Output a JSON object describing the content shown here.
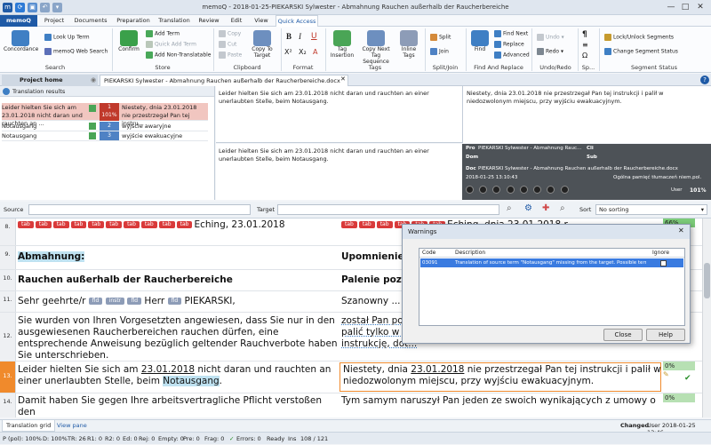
{
  "window": {
    "title": "memoQ - 2018-01-25-PIEKARSKI Sylwester - Abmahnung Rauchen außerhalb der Raucherbereiche",
    "minimize": "—",
    "maximize": "□",
    "close": "✕"
  },
  "ribbon_tabs": [
    "memoQ",
    "Project",
    "Documents",
    "Preparation",
    "Translation",
    "Review",
    "Edit",
    "View",
    "Quick Access"
  ],
  "ribbon": {
    "search": {
      "label": "Search",
      "concordance": "Concordance",
      "look_up_term": "Look Up Term",
      "web_search": "memoQ Web Search"
    },
    "store": {
      "label": "Store",
      "confirm": "Confirm",
      "add_term": "Add Term",
      "quick_add_term": "Quick Add Term",
      "add_non_translatable": "Add Non-Translatable"
    },
    "clipboard": {
      "label": "Clipboard",
      "copy": "Copy",
      "cut": "Cut",
      "paste": "Paste",
      "copy_to_target": "Copy To Target"
    },
    "format": {
      "label": "Format",
      "bold": "B",
      "italic": "I",
      "underline": "U",
      "sup": "X²",
      "sub": "X₂",
      "clear": "A"
    },
    "tags": {
      "label": "Tags",
      "tag_insertion": "Tag Insertion",
      "copy_next": "Copy Next Tag Sequence",
      "inline_tags": "Inline Tags"
    },
    "split_join": {
      "label": "Split/Join",
      "split": "Split",
      "join": "Join"
    },
    "find_replace": {
      "label": "Find And Replace",
      "find": "Find",
      "find_next": "Find Next",
      "replace": "Replace",
      "advanced": "Advanced"
    },
    "undo_redo": {
      "label": "Undo/Redo",
      "undo": "Undo",
      "redo": "Redo"
    },
    "sp": {
      "label": "Sp..."
    },
    "segment_status": {
      "label": "Segment Status",
      "lock": "Lock/Unlock Segments",
      "change_status": "Change Segment Status"
    }
  },
  "doc_tabs": {
    "home": "Project home",
    "doc": "PIEKARSKI Sylwester - Abmahnung Rauchen außerhalb der Raucherbereiche.docx"
  },
  "translation_results": {
    "title": "Translation results",
    "rows": [
      {
        "source": "Leider hielten Sie sich am 23.01.2018 nicht daran und rauchten an ...",
        "index": "1",
        "match": "101%",
        "target": "Niestety, dnia 23.01.2018 nie przestrzegał Pan tej instru..."
      },
      {
        "source": "Notausgang",
        "index": "2",
        "match": "",
        "target": "wyjście awaryjne"
      },
      {
        "source": "Notausgang",
        "index": "3",
        "match": "",
        "target": "wyjście ewakuacyjne"
      }
    ]
  },
  "compare": {
    "source_top": "Leider hielten Sie sich am 23.01.2018 nicht daran und rauchten an einer unerlaubten Stelle, beim Notausgang.",
    "source_bottom": "Leider hielten Sie sich am 23.01.2018 nicht daran und rauchten an einer unerlaubten Stelle, beim Notausgang.",
    "target_top": "Niestety, dnia 23.01.2018 nie przestrzegał Pan tej instrukcji i palił w niedozwolonym miejscu, przy wyjściu ewakuacyjnym."
  },
  "meta": {
    "pro_label": "Pro",
    "pro_value": "PIEKARSKI Sylwester - Abmahnung Rauc...",
    "cli_label": "Cli",
    "dom_label": "Dom",
    "sub_label": "Sub",
    "doc_label": "Doc",
    "doc_value": "PIEKARSKI Sylwester - Abmahnung Rauchen außerhalb der Raucherbereiche.docx",
    "date": "2018-01-25 13:10:43",
    "tm": "Ogólna pamięć tłumaczeń niem.pol.",
    "user": "User",
    "percent": "101%"
  },
  "filter": {
    "source_label": "Source",
    "target_label": "Target",
    "sort_label": "Sort",
    "sort_value": "No sorting"
  },
  "tags": {
    "tab": "tab",
    "fld": "fld",
    "instr": "instr"
  },
  "segments": [
    {
      "num": "8.",
      "source": "Eching, 23.01.2018",
      "target": "Eching, dnia 23.01.2018 r.",
      "match": "66%"
    },
    {
      "num": "9.",
      "source": "Abmahnung:",
      "target": "Upomnienie:",
      "match": ""
    },
    {
      "num": "10.",
      "source": "Rauchen außerhalb der Raucherbereiche",
      "target": "Palenie poza ...",
      "match": ""
    },
    {
      "num": "11.",
      "source_a": "Sehr geehrte/r",
      "source_b": "Herr",
      "source_c": "PIEKARSKI,",
      "target": "Szanowny ...",
      "match": ""
    },
    {
      "num": "12.",
      "source": "Sie wurden von Ihren Vorgesetzten angewiesen, dass Sie nur in den ausgewiesenen Raucherbereichen rauchen dürfen, eine entsprechende Anweisung bezüglich geltender Rauchverbote haben Sie unterschrieben.",
      "target_l1": "został Pan poi...",
      "target_l2": "palić tylko w ...",
      "target_l3": "instrukcję, dot...",
      "match": ""
    },
    {
      "num": "13.",
      "source_pre": "Leider hielten Sie sich am ",
      "source_date": "23.01.2018",
      "source_mid": " nicht daran und rauchten an einer unerlaubten Stelle, beim ",
      "source_term": "Notausgang",
      "source_post": ".",
      "target_pre": "Niestety, dnia ",
      "target_date": "23.01.2018",
      "target_rest": " nie przestrzegał Pan tej instrukcji i palił w niedozwolonym miejscu, przy wyjściu ewakuacyjnym.",
      "match": "0%"
    },
    {
      "num": "14.",
      "source": "Damit haben Sie gegen Ihre arbeitsvertragliche Pflicht verstoßen den",
      "target": "Tym samym naruszył Pan jeden ze swoich wynikających z umowy o",
      "match": "0%"
    }
  ],
  "row_status": {
    "changed": "Changed",
    "user_date": "User 2018-01-25 13:46"
  },
  "warnings": {
    "title": "Warnings",
    "col_code": "Code",
    "col_desc": "Description",
    "col_ignore": "Ignore",
    "row_code": "03091",
    "row_desc": "Translation of source term \"Notausgang\" missing from the target. Possible terms: ...",
    "close": "Close",
    "help": "Help"
  },
  "bottom_tabs": {
    "grid": "Translation grid",
    "view": "View pane"
  },
  "status": {
    "p": "P (pol): 100%",
    "d": "D: 100%",
    "tr": "TR: 26",
    "r1": "R1: 0",
    "r2": "R2: 0",
    "ed": "Ed: 0",
    "rej": "Rej: 0",
    "empty": "Empty: 0",
    "pre": "Pre: 0",
    "frag": "Frag: 0",
    "errors": "Errors: 0",
    "ready": "Ready",
    "ins": "Ins",
    "pos": "108 / 121"
  },
  "colors": {
    "accent": "#1f5aa6",
    "tag_red": "#d93a3a",
    "match_red": "#c0392b",
    "term_highlight": "#bfe2f1",
    "active_row": "#f08a2c"
  }
}
